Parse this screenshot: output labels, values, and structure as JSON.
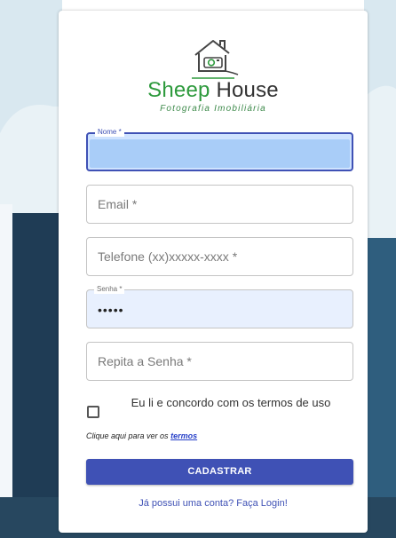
{
  "brand": {
    "name_part1": "Sheep",
    "name_part2": "House",
    "tagline": "Fotografia Imobiliária"
  },
  "form": {
    "nome": {
      "label": "Nome *",
      "value": ""
    },
    "email": {
      "placeholder": "Email *"
    },
    "telefone": {
      "placeholder": "Telefone (xx)xxxxx-xxxx *"
    },
    "senha": {
      "label": "Senha *",
      "value": "•••••"
    },
    "repita_senha": {
      "placeholder": "Repita a Senha *"
    },
    "terms_text": "Eu li e concordo com os termos de uso",
    "terms_hint": "Clique aqui para ver os",
    "terms_link": "termos",
    "submit_label": "CADASTRAR",
    "login_link": "Já possui uma conta? Faça Login!"
  },
  "colors": {
    "primary": "#3f51b5",
    "brand_green": "#2e9a3d",
    "background_dark": "#1e3a52",
    "background_light": "#d9e8f0"
  }
}
